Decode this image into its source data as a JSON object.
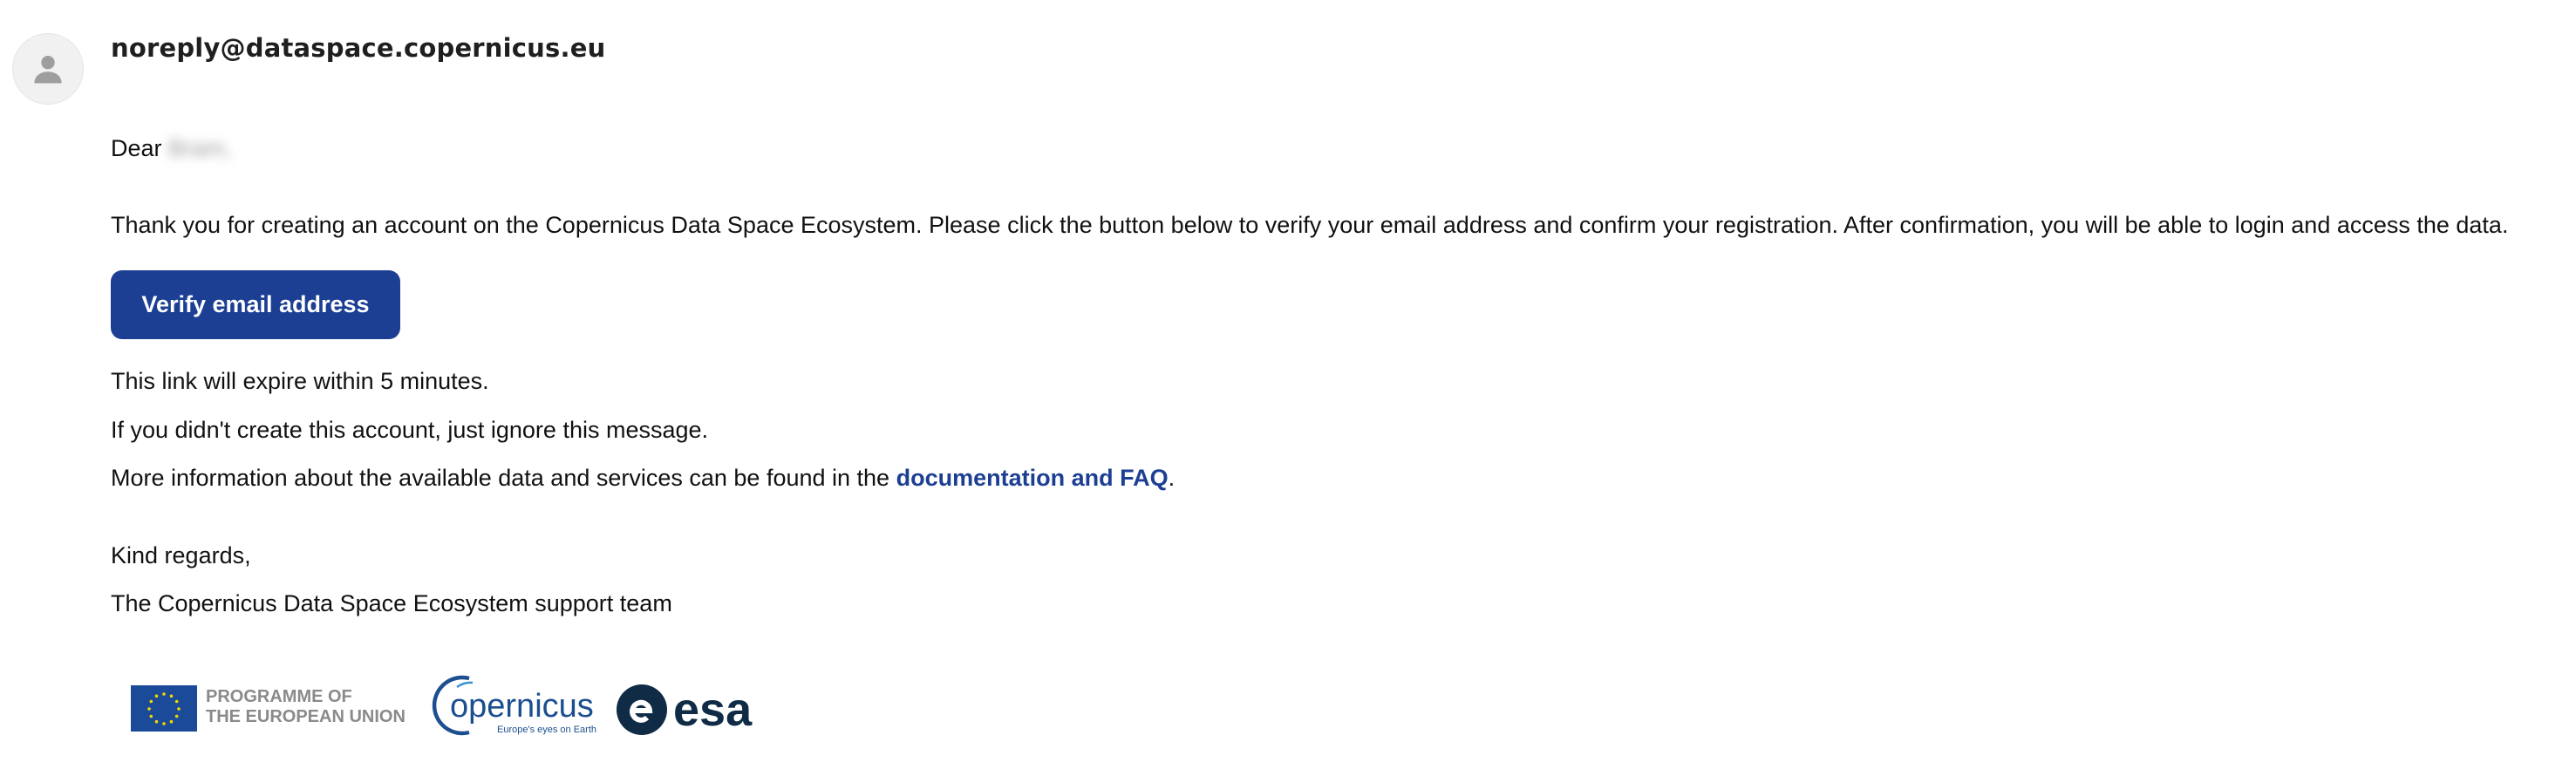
{
  "email": {
    "sender": "noreply@dataspace.copernicus.eu",
    "greeting_prefix": "Dear",
    "recipient_name": "Bram,",
    "intro": "Thank you for creating an account on the Copernicus Data Space Ecosystem. Please click the button below to verify your email address and confirm your registration. After confirmation, you will be able to login and access the data.",
    "verify_button": "Verify email address",
    "expiry_note": "This link will expire within 5 minutes.",
    "ignore_note": "If you didn't create this account, just ignore this message.",
    "info_prefix": "More information about the available data and services can be found in the",
    "info_link": "documentation and FAQ",
    "info_suffix": ".",
    "closing": "Kind regards,",
    "signature": "The Copernicus Data Space Ecosystem support team"
  },
  "footer_logos": {
    "eu_line1": "PROGRAMME OF",
    "eu_line2": "THE EUROPEAN UNION",
    "copernicus_name": "opernicus",
    "copernicus_tagline": "Europe's eyes on Earth",
    "esa_name": "esa"
  },
  "colors": {
    "brand_blue": "#1c3f94",
    "esa_navy": "#0f2b46",
    "eu_blue": "#1a4a98",
    "eu_star": "#f5d800"
  }
}
